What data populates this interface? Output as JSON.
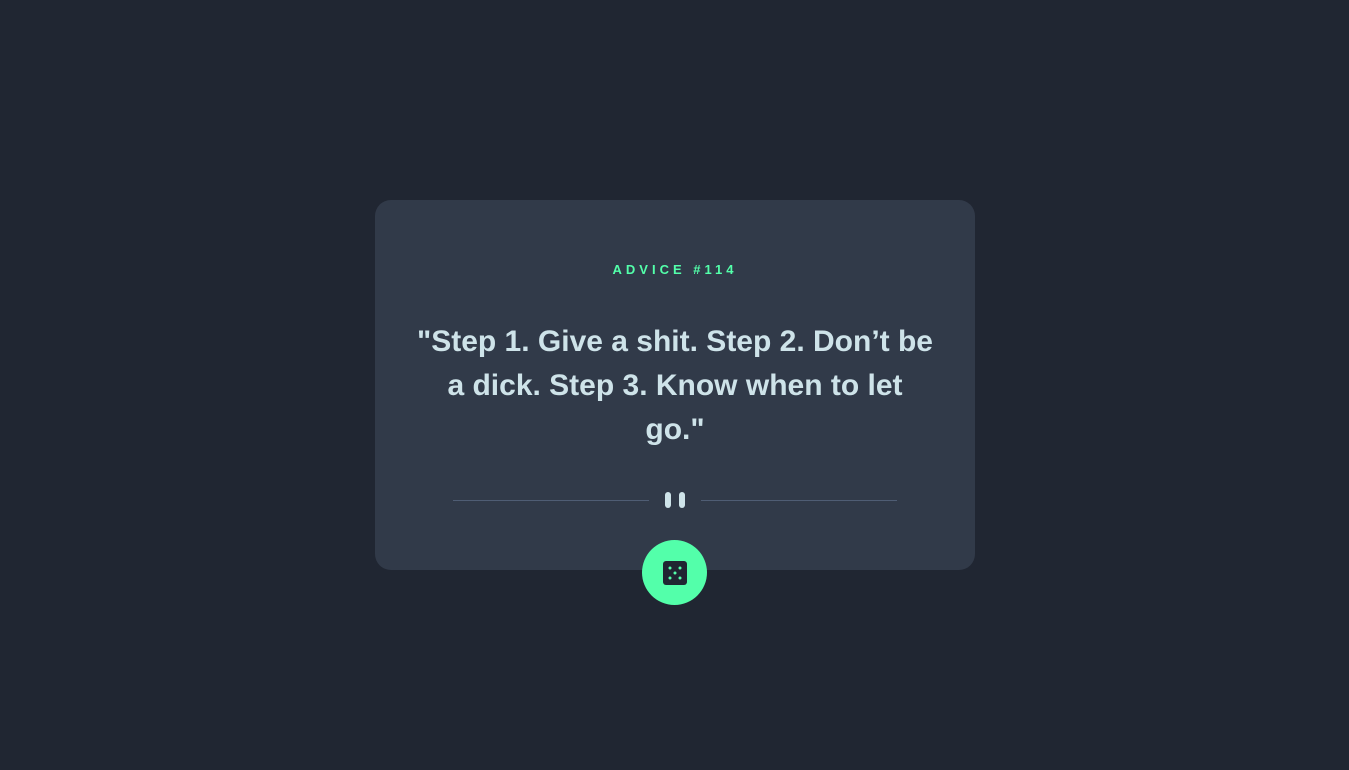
{
  "card": {
    "advice_label": "ADVICE #114",
    "advice_text": "\"Step 1. Give a shit. Step 2. Don’t be a dick. Step 3. Know when to let go.\""
  },
  "divider": {
    "icon": "pause-icon"
  },
  "dice_button": {
    "icon": "dice-icon"
  },
  "colors": {
    "background": "#202632",
    "card": "#313a49",
    "accent": "#53ffaa",
    "text": "#cee3e9",
    "divider": "#4f5d74"
  }
}
